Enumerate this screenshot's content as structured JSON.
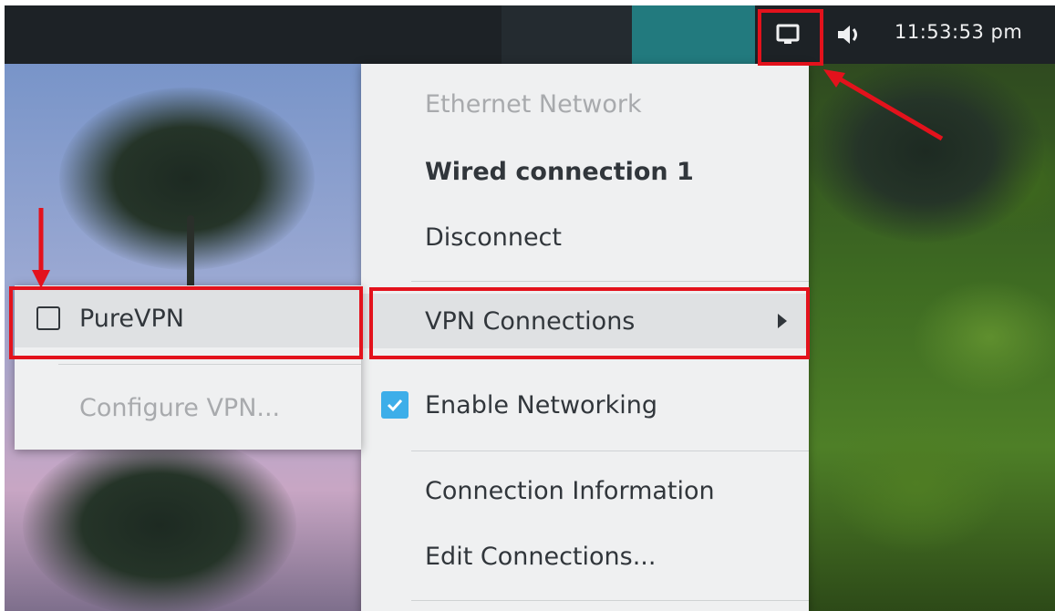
{
  "panel": {
    "clock": "11:53:53 pm",
    "network_icon": "network-wired-icon",
    "volume_icon": "volume-icon"
  },
  "network_menu": {
    "section_header": "Ethernet Network",
    "connection_name": "Wired connection 1",
    "disconnect": "Disconnect",
    "vpn_connections": "VPN Connections",
    "enable_networking": "Enable Networking",
    "enable_networking_checked": true,
    "connection_information": "Connection Information",
    "edit_connections": "Edit Connections..."
  },
  "vpn_submenu": {
    "items": [
      {
        "label": "PureVPN",
        "checked": false
      }
    ],
    "configure": "Configure VPN..."
  },
  "colors": {
    "highlight": "#e3121c",
    "accent": "#3daee9",
    "panel": "#1d2226",
    "task_active": "#227a7e"
  }
}
